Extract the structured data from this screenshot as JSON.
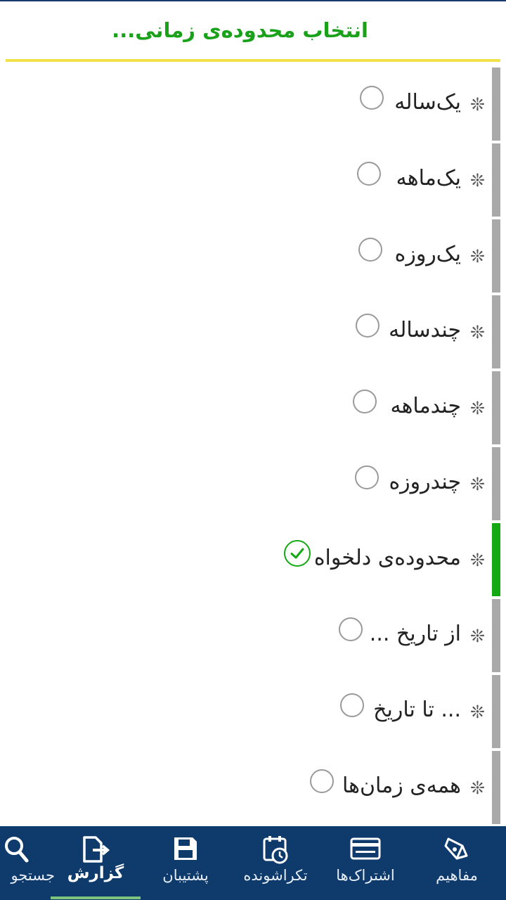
{
  "header": {
    "title": "انتخاب محدوده‌ی زمانی..."
  },
  "options": [
    {
      "label": "یک‌ساله",
      "selected": false
    },
    {
      "label": "یک‌ماهه",
      "selected": false
    },
    {
      "label": "یک‌روزه",
      "selected": false
    },
    {
      "label": "چندساله",
      "selected": false
    },
    {
      "label": "چندماهه",
      "selected": false
    },
    {
      "label": "چندروزه",
      "selected": false
    },
    {
      "label": "محدوده‌ی دلخواه",
      "selected": true
    },
    {
      "label": "از تاریخ ...",
      "selected": false
    },
    {
      "label": "... تا تاریخ",
      "selected": false
    },
    {
      "label": "همه‌ی زمان‌ها",
      "selected": false
    }
  ],
  "bullet": "❊",
  "nav": [
    {
      "label": "مفاهیم",
      "icon": "pen-nib-icon"
    },
    {
      "label": "اشتراک‌ها",
      "icon": "card-icon"
    },
    {
      "label": "تکراشونده",
      "icon": "calendar-clock-icon"
    },
    {
      "label": "پشتیبان",
      "icon": "floppy-icon"
    },
    {
      "label": "گزارش",
      "icon": "export-file-icon",
      "active": true
    },
    {
      "label": "جستجو",
      "icon": "search-icon"
    }
  ],
  "colors": {
    "accent": "#1aa11a",
    "nav_bg": "#0e3a6c",
    "rule": "#f2e24a"
  }
}
